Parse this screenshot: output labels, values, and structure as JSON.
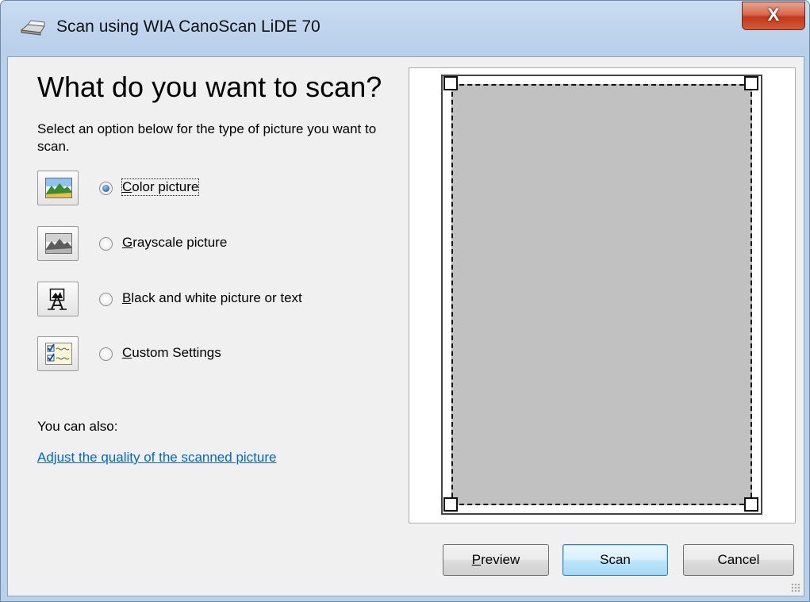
{
  "window": {
    "title": "Scan using WIA CanoScan LiDE 70",
    "close_glyph": "X"
  },
  "main": {
    "heading": "What do you want to scan?",
    "description": "Select an option below for the type of picture you want to scan.",
    "options": [
      {
        "icon": "color-picture-icon",
        "label": "Color picture",
        "access_key": "C",
        "rest": "olor picture",
        "selected": true
      },
      {
        "icon": "grayscale-picture-icon",
        "label": "Grayscale picture",
        "access_key": "G",
        "rest": "rayscale picture",
        "selected": false
      },
      {
        "icon": "black-white-text-icon",
        "label": "Black and white picture or text",
        "access_key": "B",
        "rest": "lack and white picture or text",
        "selected": false
      },
      {
        "icon": "custom-settings-icon",
        "label": "Custom Settings",
        "access_key": "C",
        "rest": "ustom Settings",
        "selected": false
      }
    ],
    "also_text": "You can also:",
    "quality_link": "Adjust the quality of the scanned picture"
  },
  "buttons": {
    "preview_key": "P",
    "preview_rest": "review",
    "scan": "Scan",
    "cancel": "Cancel"
  },
  "colors": {
    "title_bar": "#b9d0ea",
    "close_button": "#c0391c",
    "link": "#0066cc",
    "scan_area": "#c1c1c1"
  }
}
